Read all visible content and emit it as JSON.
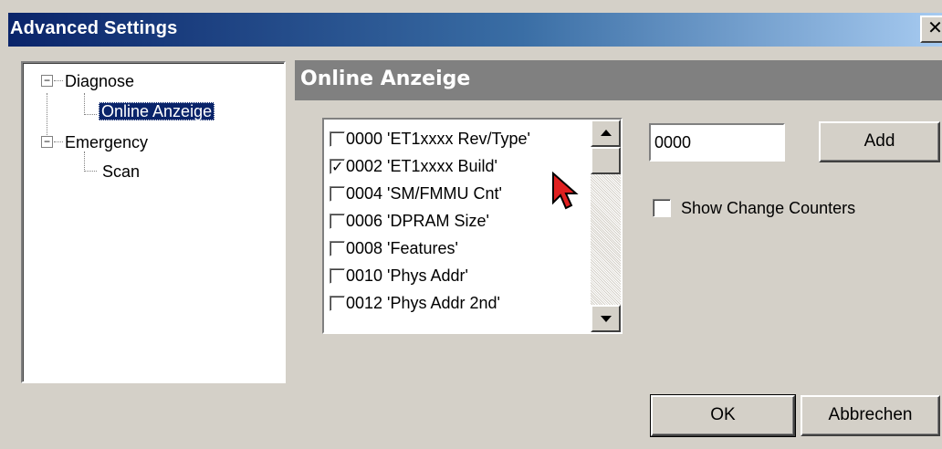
{
  "window": {
    "title": "Advanced Settings",
    "close_glyph": "✕"
  },
  "tree": {
    "items": [
      {
        "label": "Diagnose",
        "expanded": true
      },
      {
        "label": "Online Anzeige",
        "selected": true
      },
      {
        "label": "Emergency",
        "expanded": true
      },
      {
        "label": "Scan"
      }
    ],
    "expander_glyph": "−"
  },
  "panel": {
    "header": "Online Anzeige"
  },
  "list": {
    "items": [
      {
        "label": "0000 'ET1xxxx Rev/Type'",
        "checked": false
      },
      {
        "label": "0002 'ET1xxxx Build'",
        "checked": true
      },
      {
        "label": "0004 'SM/FMMU Cnt'",
        "checked": false
      },
      {
        "label": "0006 'DPRAM Size'",
        "checked": false
      },
      {
        "label": "0008 'Features'",
        "checked": false
      },
      {
        "label": "0010 'Phys Addr'",
        "checked": false
      },
      {
        "label": "0012 'Phys Addr 2nd'",
        "checked": false
      }
    ]
  },
  "address_input": {
    "value": "0000"
  },
  "buttons": {
    "add": "Add",
    "ok": "OK",
    "cancel": "Abbrechen"
  },
  "show_change_counters": {
    "label": "Show Change Counters",
    "checked": false
  },
  "colors": {
    "title_start": "#0a246a",
    "title_end": "#a6caf0",
    "selection": "#0a246a",
    "cursor": "#e02020"
  }
}
